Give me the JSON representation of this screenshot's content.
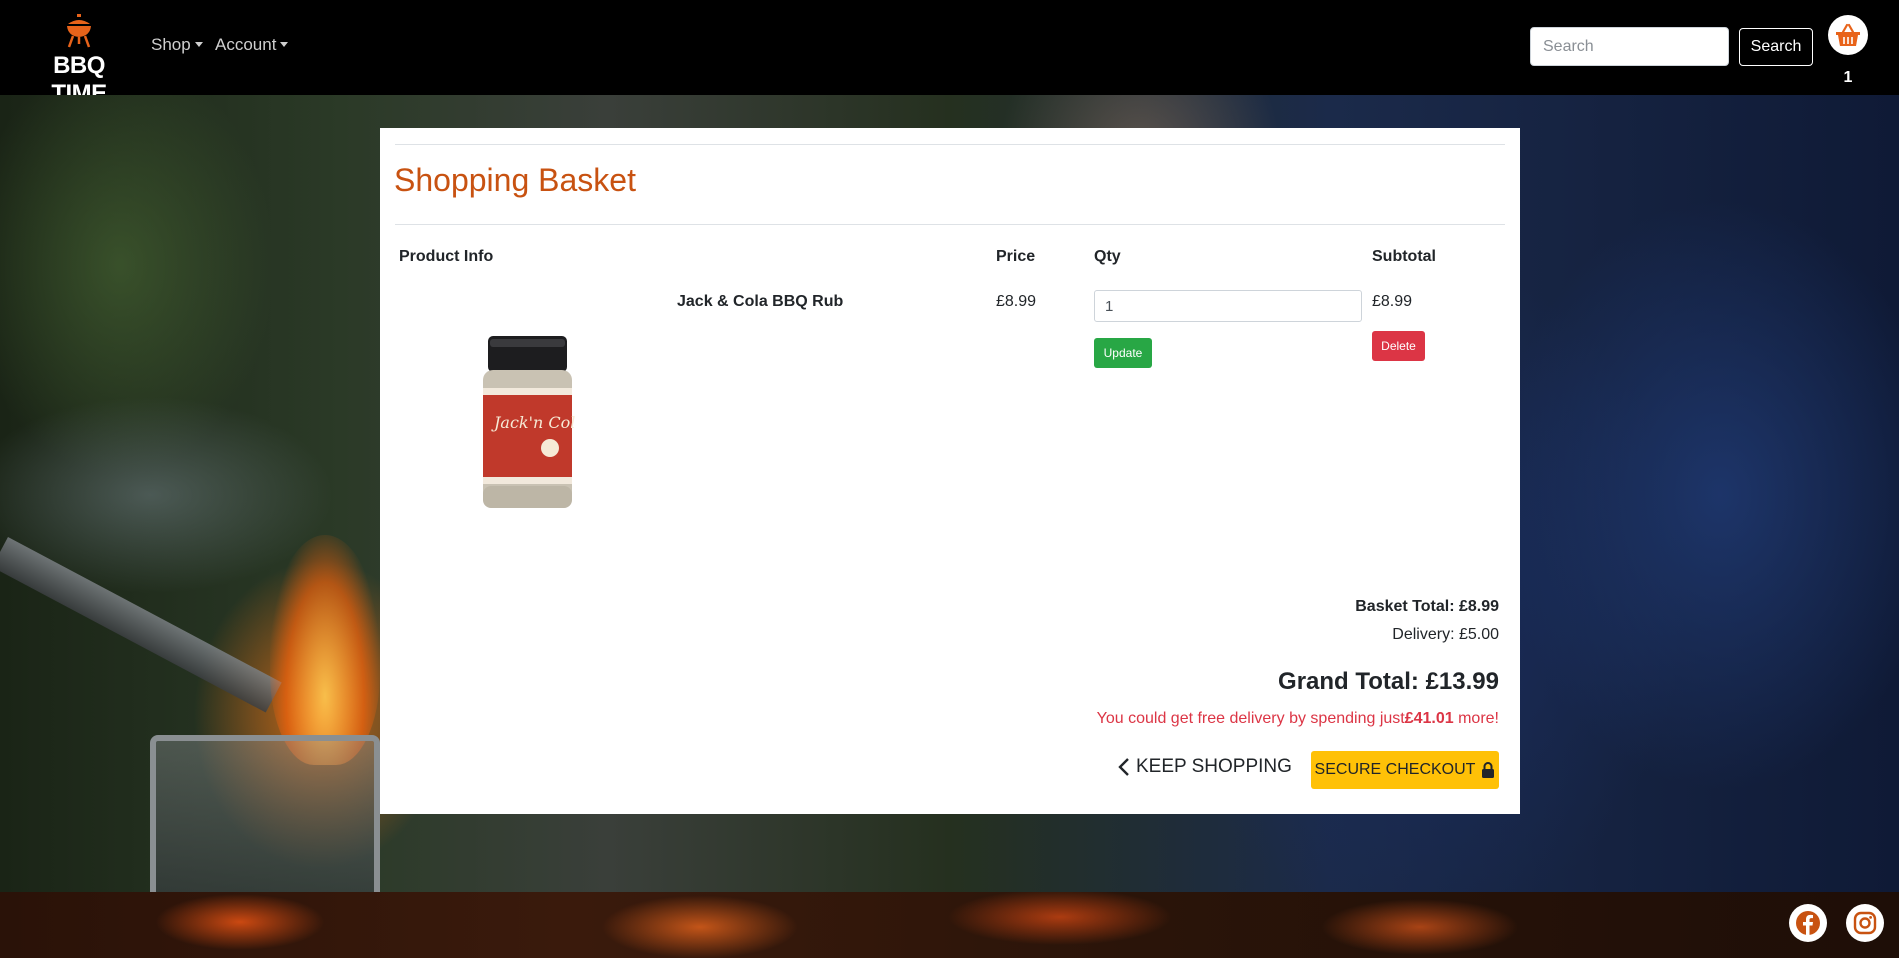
{
  "brand": {
    "name": "BBQ TIME",
    "icon": "bbq-grill-icon",
    "color": "#e8631a"
  },
  "nav": {
    "items": [
      {
        "label": "Shop"
      },
      {
        "label": "Account"
      }
    ]
  },
  "search": {
    "placeholder": "Search",
    "button_label": "Search"
  },
  "basket_nav": {
    "icon": "basket-icon",
    "count": "1"
  },
  "basket": {
    "title": "Shopping Basket",
    "headers": {
      "product": "Product Info",
      "price": "Price",
      "qty": "Qty",
      "subtotal": "Subtotal"
    },
    "items": [
      {
        "name": "Jack & Cola BBQ Rub",
        "price": "£8.99",
        "qty": "1",
        "subtotal": "£8.99",
        "update_label": "Update",
        "delete_label": "Delete",
        "image_label": "Jack'n Cola"
      }
    ],
    "basket_total": "Basket Total: £8.99",
    "delivery": "Delivery: £5.00",
    "grand_total": "Grand Total: £13.99",
    "free_delivery": {
      "prefix": "You could get free delivery by spending just",
      "amount": "£41.01",
      "suffix": " more!"
    },
    "keep_shopping_label": "KEEP SHOPPING",
    "checkout_label": "SECURE CHECKOUT"
  },
  "social": [
    {
      "icon": "facebook-icon"
    },
    {
      "icon": "instagram-icon"
    }
  ],
  "colors": {
    "accent": "#c85211",
    "update": "#28a745",
    "delete": "#dc3545",
    "checkout": "#ffc107",
    "warning_text": "#dc3545"
  }
}
